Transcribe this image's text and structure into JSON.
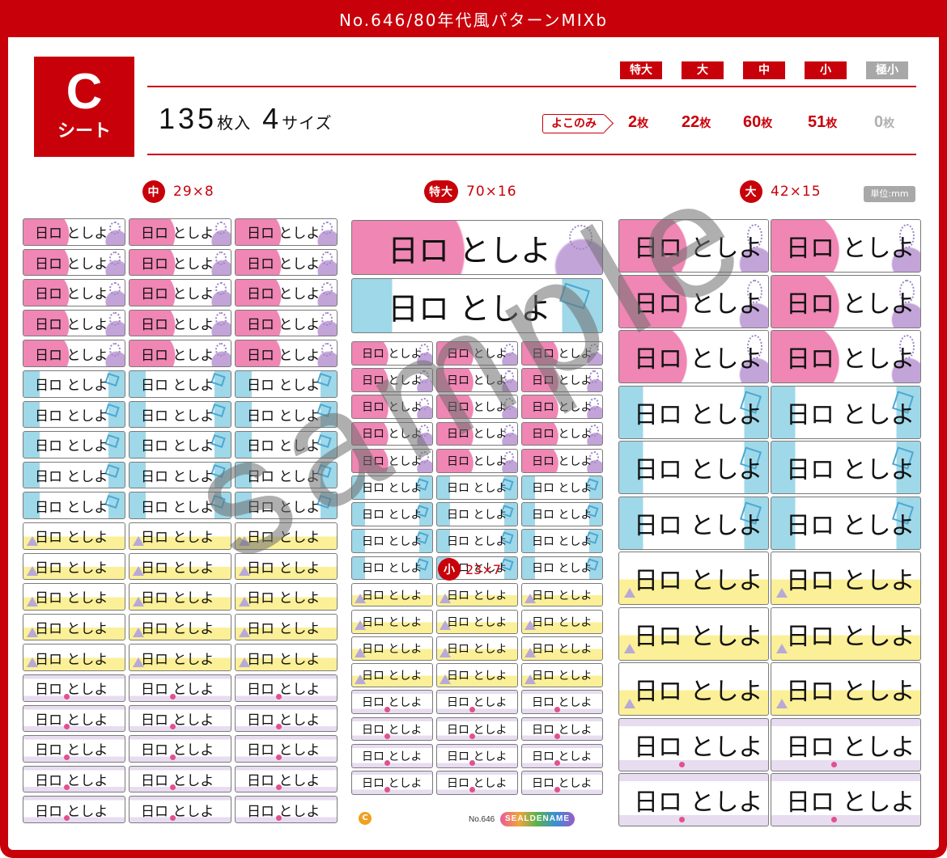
{
  "header": {
    "title": "No.646/80年代風パターンMIXb"
  },
  "sheet": {
    "letter": "C",
    "word": "シート",
    "count_main": "135",
    "count_unit": "枚入",
    "sizes_main": "4",
    "sizes_unit": "サイズ"
  },
  "size_tags": [
    "特大",
    "大",
    "中",
    "小",
    "極小"
  ],
  "orientation_label": "よこのみ",
  "counts": [
    {
      "value": "2",
      "unit": "枚"
    },
    {
      "value": "22",
      "unit": "枚"
    },
    {
      "value": "60",
      "unit": "枚"
    },
    {
      "value": "51",
      "unit": "枚"
    },
    {
      "value": "0",
      "unit": "枚"
    }
  ],
  "sections": {
    "medium": {
      "tag": "中",
      "dims": "29×8"
    },
    "xlarge": {
      "tag": "特大",
      "dims": "70×16"
    },
    "large": {
      "tag": "大",
      "dims": "42×15"
    },
    "small": {
      "tag": "小",
      "dims": "23×7"
    }
  },
  "unit_note": "単位:mm",
  "label_text": "日ロ としよ",
  "watermark": "sample",
  "footer": {
    "circle": "C",
    "number": "No.646",
    "brand": "SEALDENAME"
  },
  "colors": {
    "brand_red": "#c8000a",
    "disabled_gray": "#a8a8a8",
    "pink": "#ef86b3",
    "blue": "#9fd8e8",
    "yellow": "#fbf097",
    "lavender": "#e7dcf0"
  }
}
